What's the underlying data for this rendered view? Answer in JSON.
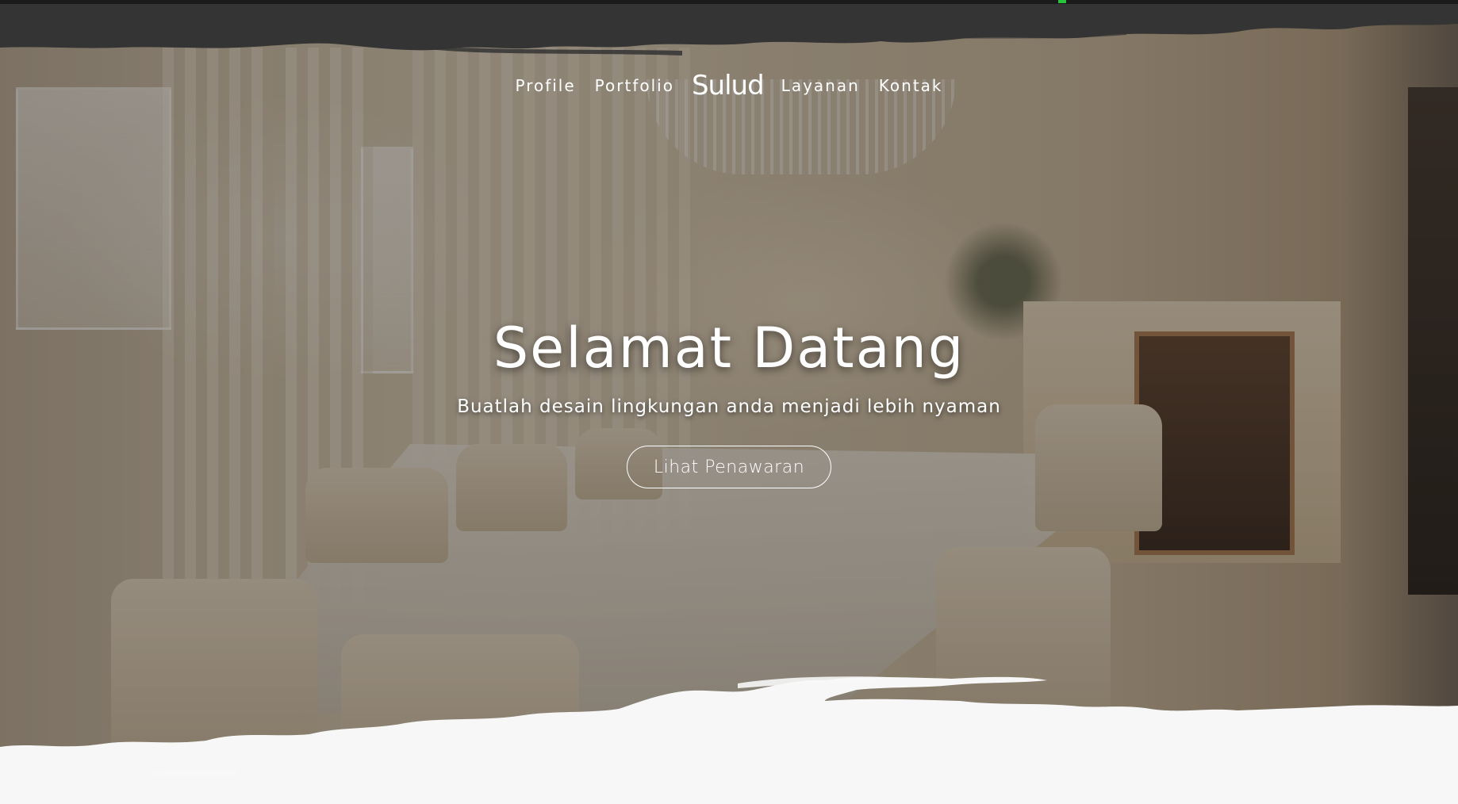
{
  "nav": {
    "items_left": [
      {
        "label": "Profile"
      },
      {
        "label": "Portfolio"
      }
    ],
    "brand": "Sulud",
    "items_right": [
      {
        "label": "Layanan"
      },
      {
        "label": "Kontak"
      }
    ]
  },
  "hero": {
    "title": "Selamat Datang",
    "subtitle": "Buatlah desain lingkungan anda menjadi lebih nyaman",
    "cta_label": "Lihat Penawaran",
    "background_image": "dining-room-interior"
  },
  "colors": {
    "top_band": "#343434",
    "bottom_band": "#f7f7f7",
    "text": "#ffffff",
    "overlay": "rgba(40,36,32,0.42)"
  }
}
